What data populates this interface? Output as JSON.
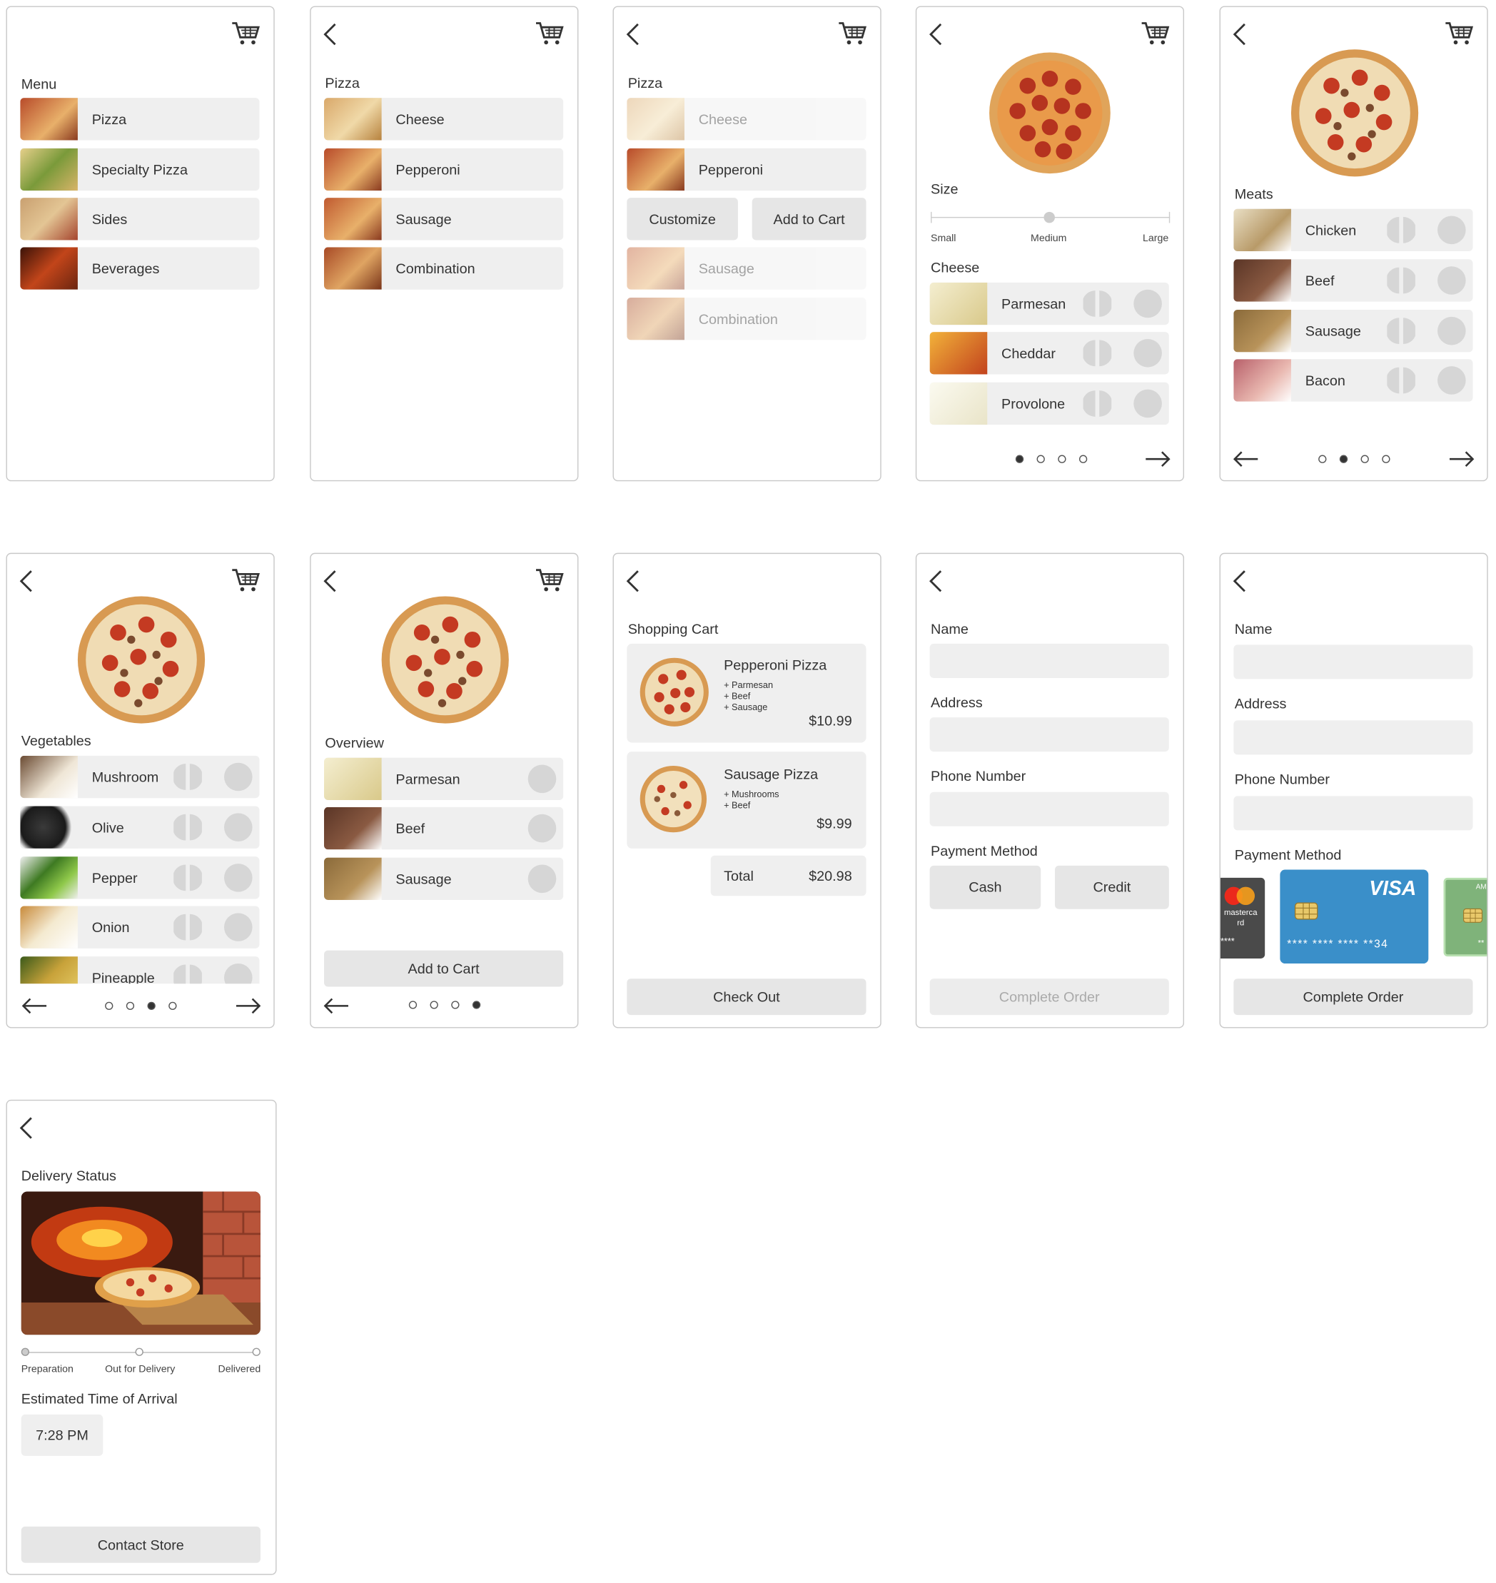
{
  "colors": {
    "panel": "#efefef",
    "border": "#c8c8c8",
    "text": "#333333",
    "visa": "#3a8fc9"
  },
  "icons": [
    "cart-icon",
    "back-chevron-icon",
    "arrow-left-icon",
    "arrow-right-icon",
    "toggle-half-icon",
    "check-circle-icon"
  ],
  "s1": {
    "title": "Menu",
    "items": [
      "Pizza",
      "Specialty Pizza",
      "Sides",
      "Beverages"
    ]
  },
  "s2": {
    "title": "Pizza",
    "items": [
      "Cheese",
      "Pepperoni",
      "Sausage",
      "Combination"
    ]
  },
  "s3": {
    "title": "Pizza",
    "items": [
      "Cheese",
      "Pepperoni",
      "Sausage",
      "Combination"
    ],
    "customize": "Customize",
    "add": "Add to Cart"
  },
  "s4": {
    "size_label": "Size",
    "sizes": [
      "Small",
      "Medium",
      "Large"
    ],
    "selected_size": "Medium",
    "section": "Cheese",
    "items": [
      "Parmesan",
      "Cheddar",
      "Provolone"
    ],
    "page": "1 of 4"
  },
  "s5": {
    "section": "Meats",
    "items": [
      "Chicken",
      "Beef",
      "Sausage",
      "Bacon"
    ],
    "page": "2 of 4"
  },
  "s6": {
    "section": "Vegetables",
    "items": [
      "Mushroom",
      "Olive",
      "Pepper",
      "Onion",
      "Pineapple"
    ],
    "page": "3 of 4"
  },
  "s7": {
    "section": "Overview",
    "items": [
      "Parmesan",
      "Beef",
      "Sausage"
    ],
    "add": "Add to Cart",
    "page": "4 of 4"
  },
  "s8": {
    "title": "Shopping Cart",
    "items": [
      {
        "name": "Pepperoni Pizza",
        "mods": [
          "+ Parmesan",
          "+ Beef",
          "+ Sausage"
        ],
        "price": "$10.99"
      },
      {
        "name": "Sausage Pizza",
        "mods": [
          "+ Mushrooms",
          "+ Beef"
        ],
        "price": "$9.99"
      }
    ],
    "total_label": "Total",
    "total": "$20.98",
    "checkout": "Check Out"
  },
  "s9": {
    "name": "Name",
    "address": "Address",
    "phone": "Phone Number",
    "payment": "Payment Method",
    "cash": "Cash",
    "credit": "Credit",
    "complete": "Complete Order"
  },
  "s10": {
    "name": "Name",
    "address": "Address",
    "phone": "Phone Number",
    "payment": "Payment Method",
    "complete": "Complete Order",
    "mastercard_label": "masterca rd",
    "mastercard_number": "****",
    "visa_label": "VISA",
    "visa_number": "**** **** **** **34",
    "amex_label": "AM",
    "amex_number": "**"
  },
  "s11": {
    "title": "Delivery Status",
    "stages": [
      "Preparation",
      "Out for Delivery",
      "Delivered"
    ],
    "eta_label": "Estimated Time of Arrival",
    "eta": "7:28 PM",
    "contact": "Contact Store"
  }
}
